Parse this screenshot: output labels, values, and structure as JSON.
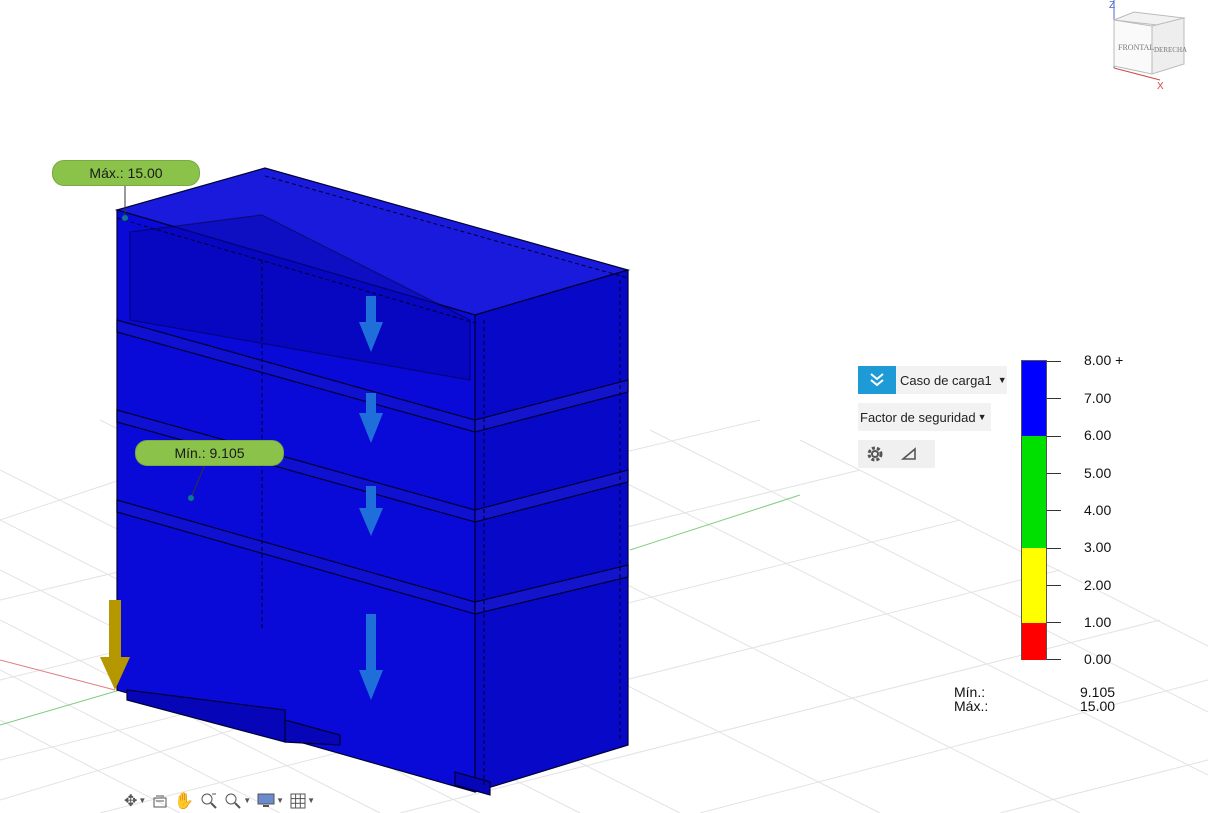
{
  "probes": {
    "max_label": "Máx.: 15.00",
    "min_label": "Mín.: 9.105"
  },
  "load_case": {
    "label": "Caso de carga1",
    "icon": "double-chevron-down-icon"
  },
  "result_type": {
    "label": "Factor de seguridad"
  },
  "tools": {
    "settings_icon": "gear-icon",
    "deformation_icon": "triangle-icon"
  },
  "legend": {
    "labels": [
      "8.00 +",
      "7.00",
      "6.00",
      "5.00",
      "4.00",
      "3.00",
      "2.00",
      "1.00",
      "0.00"
    ],
    "colors": {
      "blue": "#0000ff",
      "green": "#00e000",
      "yellow": "#ffff00",
      "red": "#ff0000"
    },
    "min_label": "Mín.:",
    "max_label": "Máx.:",
    "min_value": "9.105",
    "max_value": "15.00"
  },
  "viewcube": {
    "front": "FRONTAL",
    "right": "DERECHA",
    "axis_z": "Z",
    "axis_x": "X"
  },
  "nav_tools": [
    "orbit-icon",
    "look-at-icon",
    "pan-hand-icon",
    "zoom-window-icon",
    "zoom-icon",
    "display-settings-icon",
    "grid-icon"
  ],
  "colors": {
    "model": "#0a0acc",
    "arrow": "#1e6fd9",
    "constraint_arrow": "#b59800",
    "probe": "#8bc34a",
    "accent": "#1e9bd7"
  }
}
